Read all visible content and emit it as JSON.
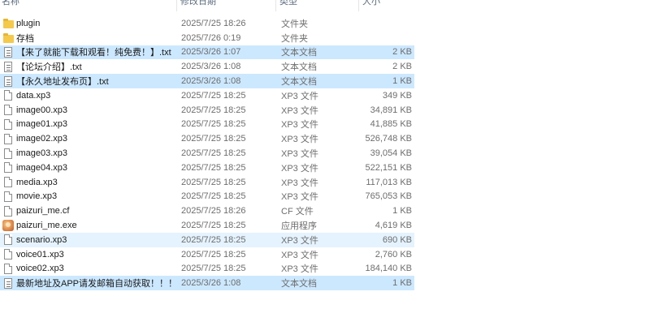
{
  "columns": {
    "name": "名称",
    "date": "修改日期",
    "type": "类型",
    "size": "大小"
  },
  "files": [
    {
      "icon": "folder-icon",
      "name": "plugin",
      "date": "2025/7/25 18:26",
      "type": "文件夹",
      "size": "",
      "state": "normal"
    },
    {
      "icon": "folder-icon",
      "name": "存档",
      "date": "2025/7/26 0:19",
      "type": "文件夹",
      "size": "",
      "state": "normal"
    },
    {
      "icon": "text-file-icon",
      "name": "【来了就能下载和观看！纯免费！】.txt",
      "date": "2025/3/26 1:07",
      "type": "文本文档",
      "size": "2 KB",
      "state": "selected"
    },
    {
      "icon": "text-file-icon",
      "name": "【论坛介绍】.txt",
      "date": "2025/3/26 1:08",
      "type": "文本文档",
      "size": "2 KB",
      "state": "normal"
    },
    {
      "icon": "text-file-icon",
      "name": "【永久地址发布页】.txt",
      "date": "2025/3/26 1:08",
      "type": "文本文档",
      "size": "1 KB",
      "state": "selected"
    },
    {
      "icon": "file-icon",
      "name": "data.xp3",
      "date": "2025/7/25 18:25",
      "type": "XP3 文件",
      "size": "349 KB",
      "state": "normal"
    },
    {
      "icon": "file-icon",
      "name": "image00.xp3",
      "date": "2025/7/25 18:25",
      "type": "XP3 文件",
      "size": "34,891 KB",
      "state": "normal"
    },
    {
      "icon": "file-icon",
      "name": "image01.xp3",
      "date": "2025/7/25 18:25",
      "type": "XP3 文件",
      "size": "41,885 KB",
      "state": "normal"
    },
    {
      "icon": "file-icon",
      "name": "image02.xp3",
      "date": "2025/7/25 18:25",
      "type": "XP3 文件",
      "size": "526,748 KB",
      "state": "normal"
    },
    {
      "icon": "file-icon",
      "name": "image03.xp3",
      "date": "2025/7/25 18:25",
      "type": "XP3 文件",
      "size": "39,054 KB",
      "state": "normal"
    },
    {
      "icon": "file-icon",
      "name": "image04.xp3",
      "date": "2025/7/25 18:25",
      "type": "XP3 文件",
      "size": "522,151 KB",
      "state": "normal"
    },
    {
      "icon": "file-icon",
      "name": "media.xp3",
      "date": "2025/7/25 18:25",
      "type": "XP3 文件",
      "size": "117,013 KB",
      "state": "normal"
    },
    {
      "icon": "file-icon",
      "name": "movie.xp3",
      "date": "2025/7/25 18:25",
      "type": "XP3 文件",
      "size": "765,053 KB",
      "state": "normal"
    },
    {
      "icon": "file-icon",
      "name": "paizuri_me.cf",
      "date": "2025/7/25 18:26",
      "type": "CF 文件",
      "size": "1 KB",
      "state": "normal"
    },
    {
      "icon": "app-icon",
      "name": "paizuri_me.exe",
      "date": "2025/7/25 18:25",
      "type": "应用程序",
      "size": "4,619 KB",
      "state": "normal"
    },
    {
      "icon": "file-icon",
      "name": "scenario.xp3",
      "date": "2025/7/25 18:25",
      "type": "XP3 文件",
      "size": "690 KB",
      "state": "hover"
    },
    {
      "icon": "file-icon",
      "name": "voice01.xp3",
      "date": "2025/7/25 18:25",
      "type": "XP3 文件",
      "size": "2,760 KB",
      "state": "normal"
    },
    {
      "icon": "file-icon",
      "name": "voice02.xp3",
      "date": "2025/7/25 18:25",
      "type": "XP3 文件",
      "size": "184,140 KB",
      "state": "normal"
    },
    {
      "icon": "text-file-icon",
      "name": "最新地址及APP请发邮箱自动获取！！！....",
      "date": "2025/3/26 1:08",
      "type": "文本文档",
      "size": "1 KB",
      "state": "selected"
    }
  ]
}
